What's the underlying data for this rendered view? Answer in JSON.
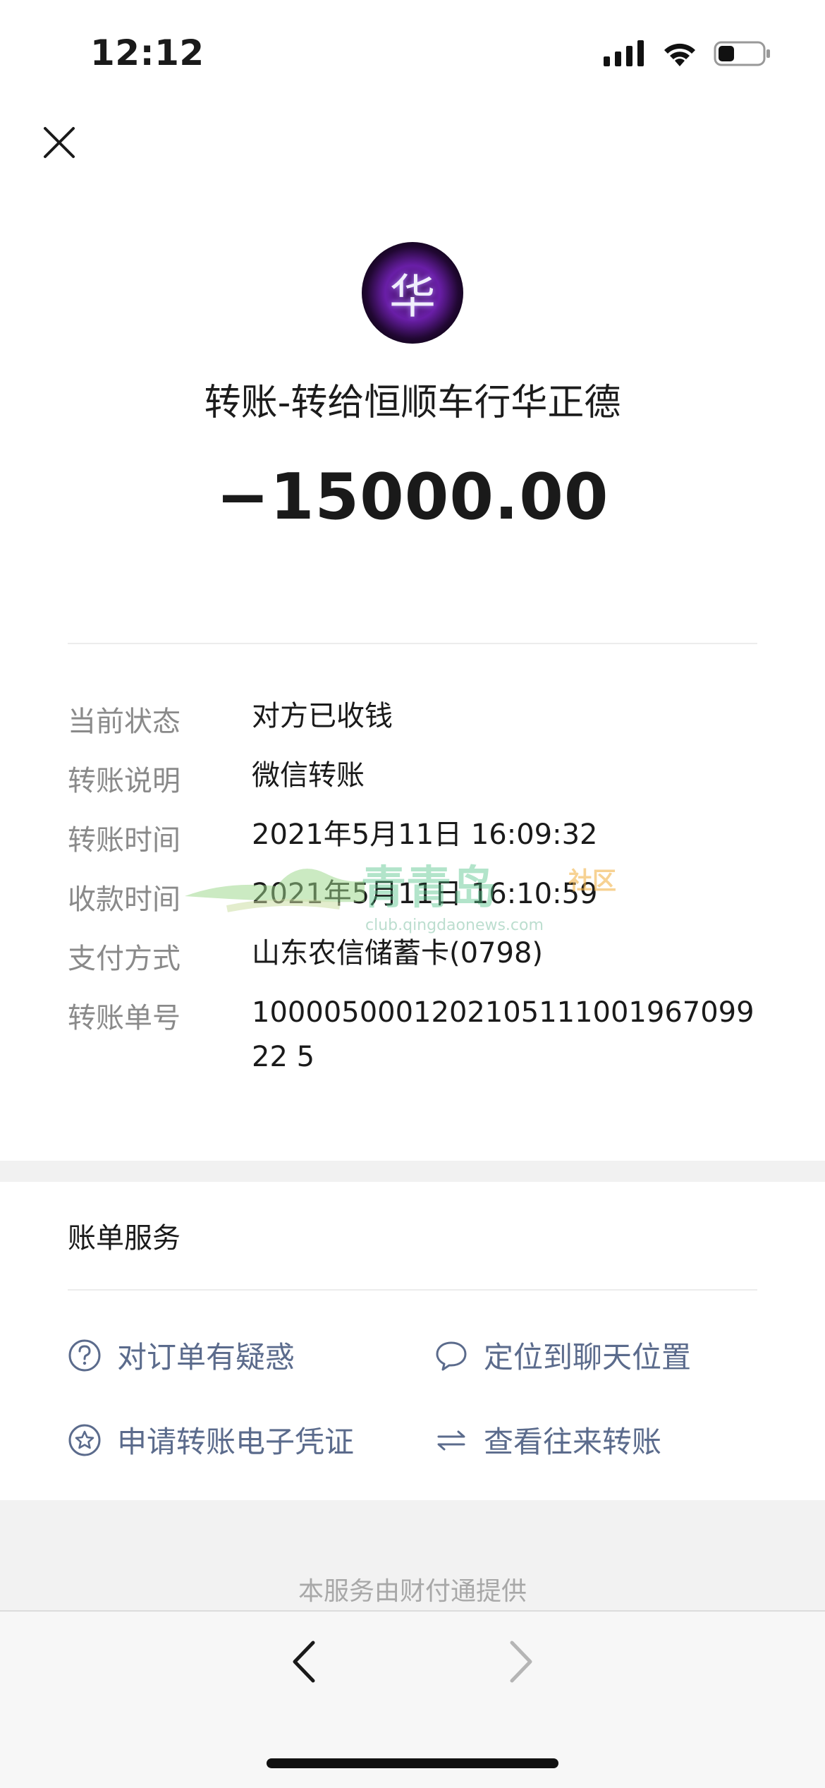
{
  "status_bar": {
    "time": "12:12"
  },
  "header": {
    "avatar_char": "华",
    "title": "转账-转给恒顺车行华正德",
    "amount": "−15000.00"
  },
  "details": [
    {
      "label": "当前状态",
      "value": "对方已收钱"
    },
    {
      "label": "转账说明",
      "value": "微信转账"
    },
    {
      "label": "转账时间",
      "value": "2021年5月11日 16:09:32"
    },
    {
      "label": "收款时间",
      "value": "2021年5月11日 16:10:59"
    },
    {
      "label": "支付方式",
      "value": "山东农信储蓄卡(0798)"
    },
    {
      "label": "转账单号",
      "value": "100005000120210511100196709922 5"
    }
  ],
  "services": {
    "title": "账单服务",
    "items": [
      {
        "label": "对订单有疑惑",
        "icon": "question-circle-icon"
      },
      {
        "label": "定位到聊天位置",
        "icon": "chat-bubble-icon"
      },
      {
        "label": "申请转账电子凭证",
        "icon": "star-circle-icon"
      },
      {
        "label": "查看往来转账",
        "icon": "exchange-arrows-icon"
      }
    ]
  },
  "watermark": {
    "brand": "青青岛",
    "tag": "社区",
    "url": "club.qingdaonews.com"
  },
  "footer": {
    "provider": "本服务由财付通提供"
  },
  "colors": {
    "link": "#5b6b8c",
    "label": "#8a8a8a",
    "text": "#1a1a1a"
  }
}
